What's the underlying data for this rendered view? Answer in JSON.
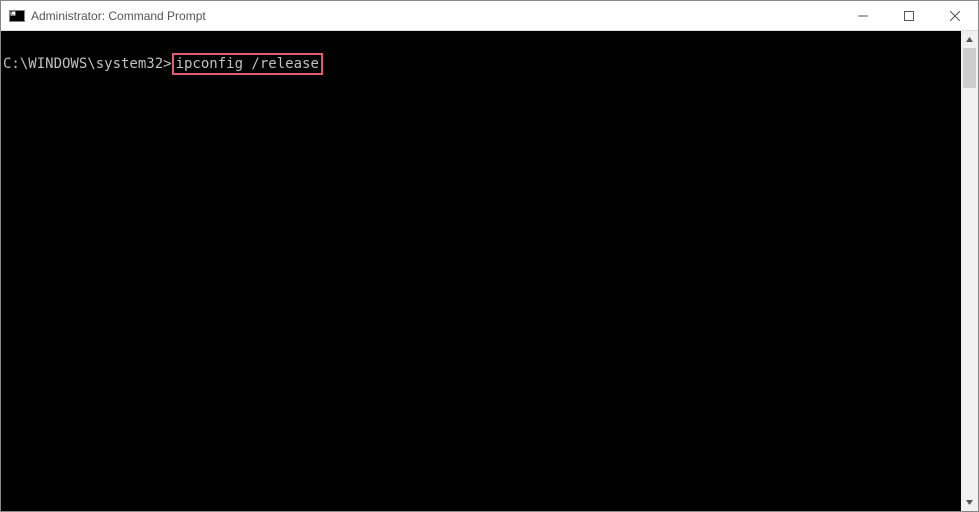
{
  "titlebar": {
    "title": "Administrator: Command Prompt"
  },
  "console": {
    "prompt": "C:\\WINDOWS\\system32>",
    "command": "ipconfig /release"
  }
}
